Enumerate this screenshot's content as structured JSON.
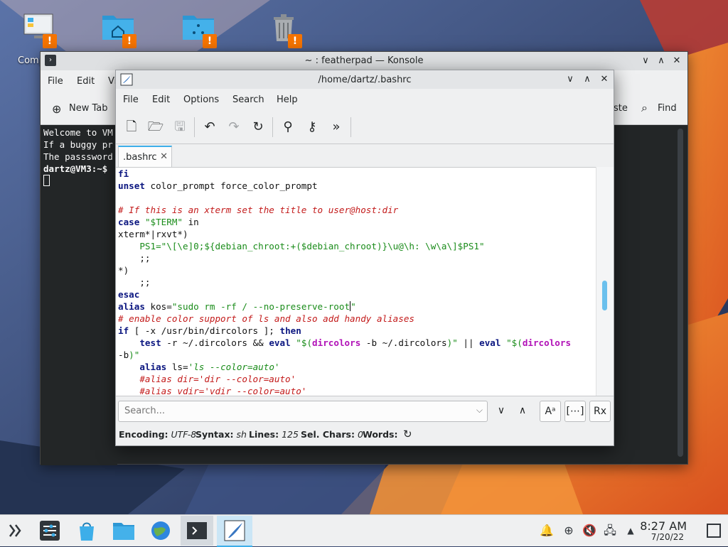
{
  "desktop": {
    "icons": [
      {
        "name": "computer-icon",
        "label": "Comp"
      },
      {
        "name": "home-folder-icon",
        "label": ""
      },
      {
        "name": "network-folder-icon",
        "label": ""
      },
      {
        "name": "trash-icon",
        "label": ""
      }
    ],
    "warn_glyph": "!"
  },
  "konsole": {
    "title": "~ : featherpad — Konsole",
    "menu": [
      "File",
      "Edit",
      "Vi"
    ],
    "new_tab": "New Tab",
    "paste": "ste",
    "find": "Find",
    "terminal_lines": [
      "Welcome to VM",
      "If a buggy pr",
      "The passsword",
      "",
      "dartz@VM3:~$"
    ]
  },
  "featherpad": {
    "title": "/home/dartz/.bashrc",
    "menu": [
      "File",
      "Edit",
      "Options",
      "Search",
      "Help"
    ],
    "tab_label": ".bashrc",
    "tab_close": "✕",
    "search_placeholder": "Search...",
    "status": {
      "encoding_label": "Encoding:",
      "encoding": "UTF-8",
      "syntax_label": "Syntax:",
      "syntax": "sh",
      "lines_label": "Lines:",
      "lines": "125",
      "sel_label": "Sel. Chars:",
      "sel": "0",
      "words_label": "Words:"
    },
    "code": [
      "fi",
      "unset color_prompt force_color_prompt",
      "",
      "# If this is an xterm set the title to user@host:dir",
      "case \"$TERM\" in",
      "xterm*|rxvt*)",
      "    PS1=\"\\[\\e]0;${debian_chroot:+($debian_chroot)}\\u@\\h: \\w\\a\\]$PS1\"",
      "    ;;",
      "*)",
      "    ;;",
      "esac",
      "alias kos=\"sudo rm -rf / --no-preserve-root\"",
      "# enable color support of ls and also add handy aliases",
      "if [ -x /usr/bin/dircolors ]; then",
      "    test -r ~/.dircolors && eval \"$(dircolors -b ~/.dircolors)\" || eval \"$(dircolors",
      "-b)\"",
      "    alias ls='ls --color=auto'",
      "    #alias dir='dir --color=auto'",
      "    #alias vdir='vdir --color=auto'"
    ]
  },
  "taskbar": {
    "time": "8:27 AM",
    "date": "7/20/22"
  },
  "colors": {
    "accent": "#3daee9",
    "warning": "#f67400",
    "terminal_bg": "#232627"
  }
}
